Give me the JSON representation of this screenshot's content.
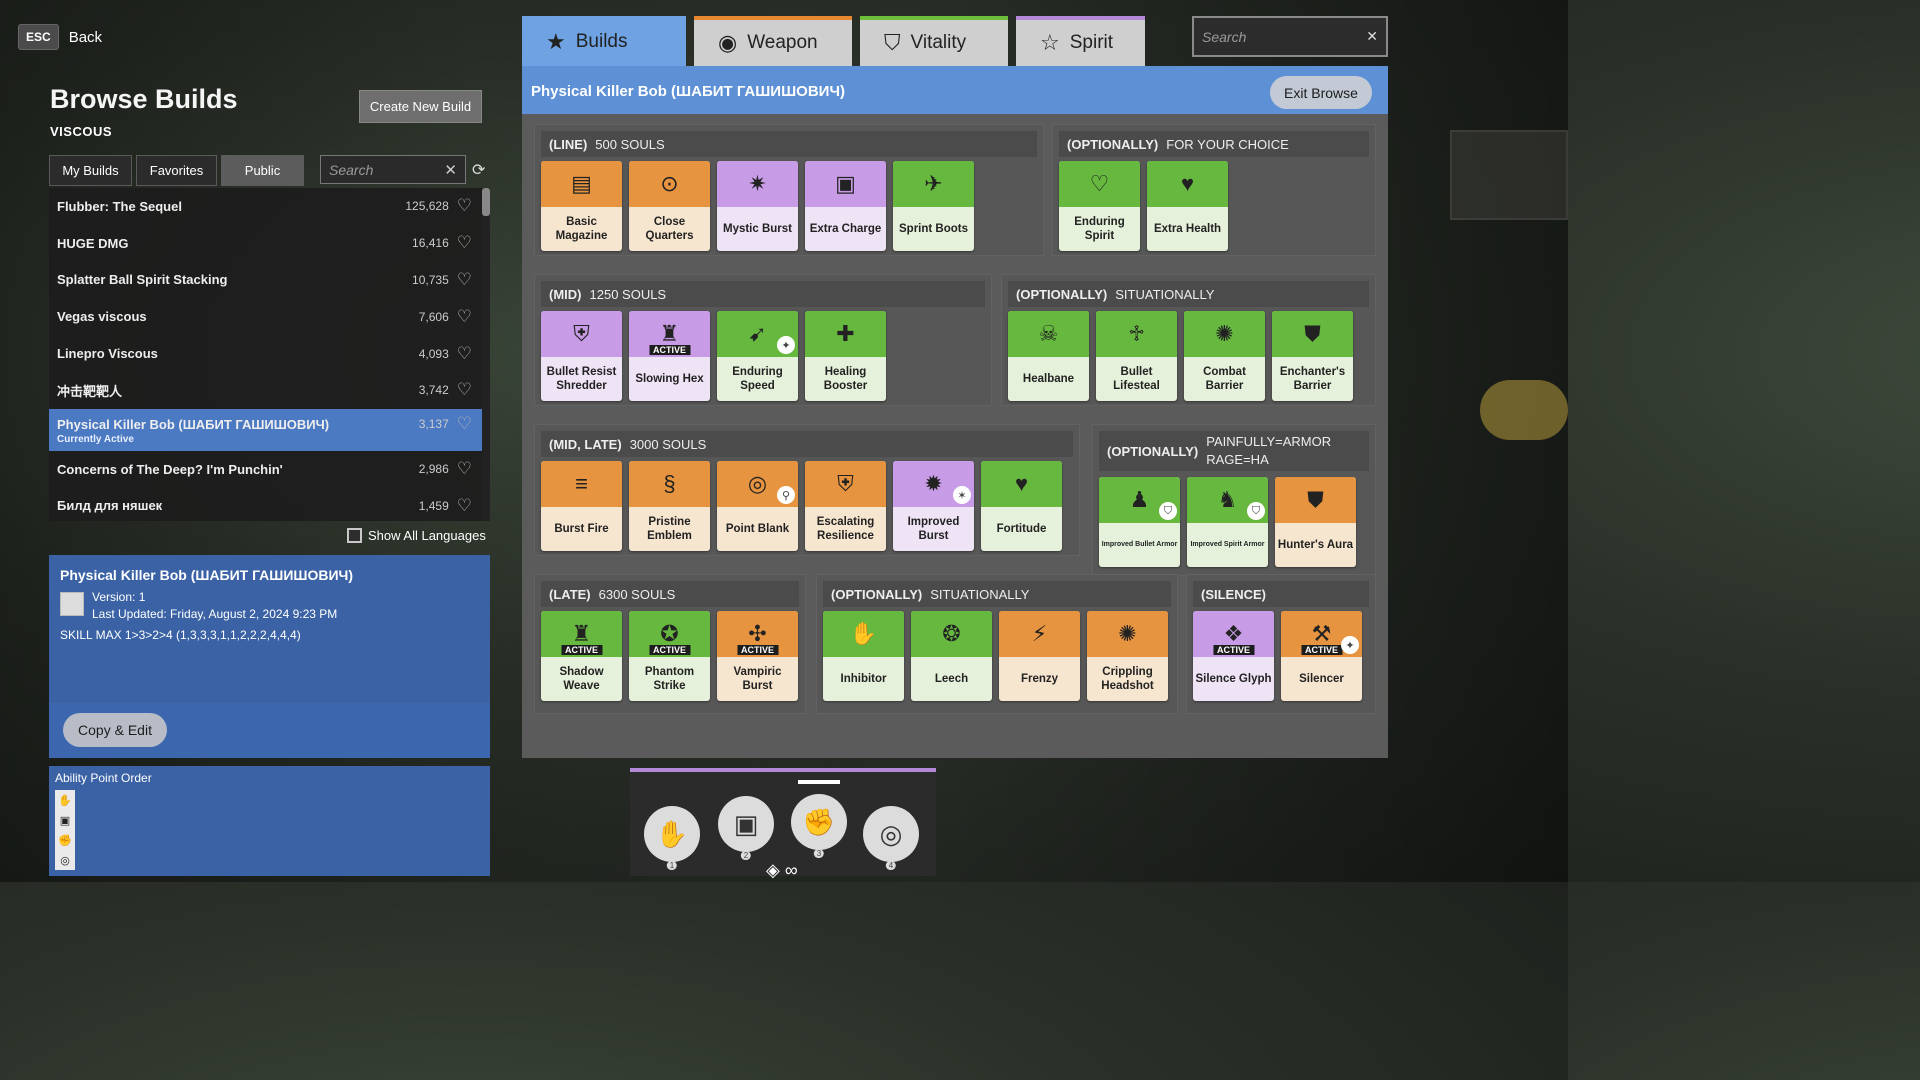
{
  "nav": {
    "esc_key": "ESC",
    "back_label": "Back"
  },
  "page": {
    "title": "Browse Builds",
    "hero": "VISCOUS",
    "create_label": "Create New Build"
  },
  "left_tabs": [
    {
      "label": "My Builds"
    },
    {
      "label": "Favorites"
    },
    {
      "label": "Public"
    }
  ],
  "left_search": {
    "placeholder": "Search"
  },
  "builds": [
    {
      "name": "Flubber: The Sequel",
      "count": "125,628"
    },
    {
      "name": "HUGE DMG",
      "count": "16,416"
    },
    {
      "name": "Splatter Ball Spirit Stacking",
      "count": "10,735"
    },
    {
      "name": "Vegas viscous",
      "count": "7,606"
    },
    {
      "name": "Linepro Viscous",
      "count": "4,093"
    },
    {
      "name": "冲击靶靶人",
      "count": "3,742"
    },
    {
      "name": "Physical Killer Bob (ШАБИТ ГАШИШОВИЧ)",
      "count": "3,137",
      "sub": "Currently Active"
    },
    {
      "name": "Concerns of The Deep? I'm Punchin'",
      "count": "2,986"
    },
    {
      "name": "Билд для няшек",
      "count": "1,459"
    }
  ],
  "show_all_languages": "Show All Languages",
  "detail": {
    "title": "Physical Killer Bob (ШАБИТ ГАШИШОВИЧ)",
    "version": "Version: 1",
    "updated": "Last Updated: Friday, August 2, 2024 9:23 PM",
    "skill": "SKILL MAX 1>3>2>4 (1,3,3,3,1,1,2,2,2,4,4,4)",
    "copy_label": "Copy & Edit"
  },
  "ability_order": {
    "label": "Ability Point Order"
  },
  "right_tabs": [
    {
      "label": "Builds",
      "icon": "star-filled-icon"
    },
    {
      "label": "Weapon",
      "icon": "weapon-icon"
    },
    {
      "label": "Vitality",
      "icon": "vitality-icon"
    },
    {
      "label": "Spirit",
      "icon": "spirit-icon"
    }
  ],
  "right_search": {
    "placeholder": "Search"
  },
  "panel": {
    "title": "Physical Killer Bob (ШАБИТ ГАШИШОВИЧ)",
    "exit_label": "Exit Browse"
  },
  "groups": [
    {
      "tag": "(LINE)",
      "desc": "500 SOULS",
      "items": [
        {
          "label": "Basic Magazine",
          "cat": "w"
        },
        {
          "label": "Close Quarters",
          "cat": "w"
        },
        {
          "label": "Mystic Burst",
          "cat": "s"
        },
        {
          "label": "Extra Charge",
          "cat": "s"
        },
        {
          "label": "Sprint Boots",
          "cat": "v"
        }
      ]
    },
    {
      "tag": "(OPTIONALLY)",
      "desc": "FOR YOUR CHOICE",
      "items": [
        {
          "label": "Enduring Spirit",
          "cat": "v"
        },
        {
          "label": "Extra Health",
          "cat": "v"
        }
      ]
    },
    {
      "tag": "(MID)",
      "desc": "1250 SOULS",
      "items": [
        {
          "label": "Bullet Resist Shredder",
          "cat": "s"
        },
        {
          "label": "Slowing Hex",
          "cat": "s",
          "active": "ACTIVE"
        },
        {
          "label": "Enduring Speed",
          "cat": "v"
        },
        {
          "label": "Healing Booster",
          "cat": "v"
        }
      ]
    },
    {
      "tag": "(OPTIONALLY)",
      "desc": "SITUATIONALLY",
      "items": [
        {
          "label": "Healbane",
          "cat": "v"
        },
        {
          "label": "Bullet Lifesteal",
          "cat": "v"
        },
        {
          "label": "Combat Barrier",
          "cat": "v"
        },
        {
          "label": "Enchanter's Barrier",
          "cat": "v"
        }
      ]
    },
    {
      "tag": "(MID, LATE)",
      "desc": "3000 SOULS",
      "items": [
        {
          "label": "Burst Fire",
          "cat": "w"
        },
        {
          "label": "Pristine Emblem",
          "cat": "w"
        },
        {
          "label": "Point Blank",
          "cat": "w"
        },
        {
          "label": "Escalating Resilience",
          "cat": "w"
        },
        {
          "label": "Improved Burst",
          "cat": "s"
        },
        {
          "label": "Fortitude",
          "cat": "v"
        }
      ]
    },
    {
      "tag": "(OPTIONALLY)",
      "desc_lines": [
        "PAINFULLY=ARMOR",
        "RAGE=HA"
      ],
      "items": [
        {
          "label": "Improved Bullet Armor",
          "cat": "v"
        },
        {
          "label": "Improved Spirit Armor",
          "cat": "v"
        },
        {
          "label": "Hunter's Aura",
          "cat": "w"
        }
      ]
    },
    {
      "tag": "(LATE)",
      "desc": "6300 SOULS",
      "items": [
        {
          "label": "Shadow Weave",
          "cat": "v",
          "active": "ACTIVE"
        },
        {
          "label": "Phantom Strike",
          "cat": "v",
          "active": "ACTIVE"
        },
        {
          "label": "Vampiric Burst",
          "cat": "w",
          "active": "ACTIVE"
        }
      ]
    },
    {
      "tag": "(OPTIONALLY)",
      "desc": "SITUATIONALLY",
      "items": [
        {
          "label": "Inhibitor",
          "cat": "v"
        },
        {
          "label": "Leech",
          "cat": "v"
        },
        {
          "label": "Frenzy",
          "cat": "w"
        },
        {
          "label": "Crippling Headshot",
          "cat": "w"
        }
      ]
    },
    {
      "tag": "(SILENCE)",
      "desc": "",
      "items": [
        {
          "label": "Silence Glyph",
          "cat": "s",
          "active": "ACTIVE"
        },
        {
          "label": "Silencer",
          "cat": "w",
          "active": "ACTIVE"
        }
      ]
    }
  ],
  "abilities": [
    {
      "num": "1",
      "icon": "ability-splash-icon"
    },
    {
      "num": "2",
      "icon": "ability-cube-icon"
    },
    {
      "num": "3",
      "icon": "ability-fist-icon"
    },
    {
      "num": "4",
      "icon": "ability-spiral-icon"
    }
  ]
}
